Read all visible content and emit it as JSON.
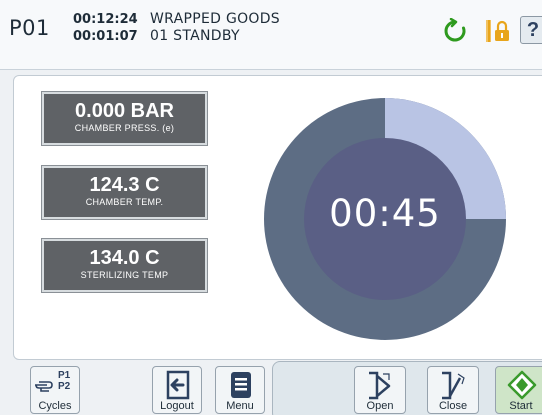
{
  "header": {
    "program": "P01",
    "elapsed_time": "00:12:24",
    "phase_time": "00:01:07",
    "cycle_name": "WRAPPED GOODS",
    "phase_name": "01 STANDBY",
    "help_label": "?"
  },
  "gauges": [
    {
      "value": "0.000 BAR",
      "label": "CHAMBER PRESS. (e)"
    },
    {
      "value": "124.3 C",
      "label": "CHAMBER TEMP."
    },
    {
      "value": "134.0 C",
      "label": "STERILIZING TEMP"
    }
  ],
  "timer": {
    "display": "00:45",
    "progress_fraction": 0.25
  },
  "buttons": {
    "cycles": "Cycles",
    "cycles_p1": "P1",
    "cycles_p2": "P2",
    "logout": "Logout",
    "menu": "Menu",
    "open": "Open",
    "close": "Close",
    "start": "Start"
  },
  "colors": {
    "ring": "#5d6d84",
    "ring_progress": "#b9c4e4",
    "inner_disk": "#5a5f85",
    "gauge_bg": "#5f6266",
    "refresh_icon": "#2e9a1e",
    "lock_icon": "#e8a51b",
    "start_icon": "#3a9a2c"
  },
  "icons": {
    "refresh": "refresh-icon",
    "lock": "lock-icon",
    "help": "help-icon",
    "cycles": "hand-pointer-icon",
    "logout": "logout-door-icon",
    "menu": "menu-document-icon",
    "open": "door-open-icon",
    "close": "door-close-icon",
    "start": "start-diamond-icon"
  }
}
